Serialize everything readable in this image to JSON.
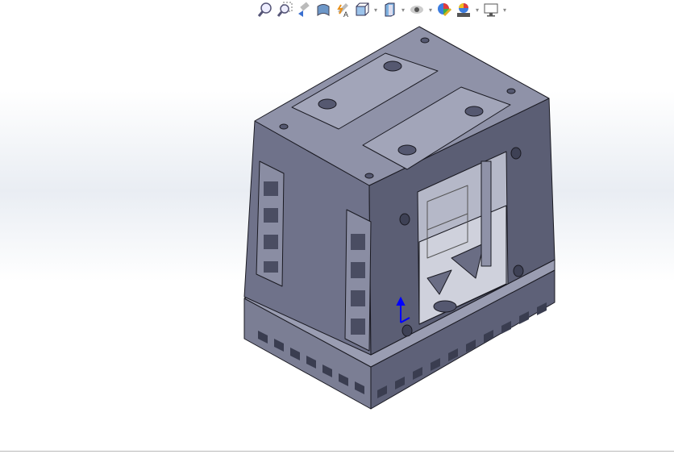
{
  "toolbar": {
    "items": [
      {
        "icon": "zoom-to-fit-icon"
      },
      {
        "icon": "zoom-to-area-icon"
      },
      {
        "icon": "previous-view-icon"
      },
      {
        "icon": "section-view-icon"
      },
      {
        "icon": "dynamic-annotation-views-icon"
      },
      {
        "icon": "view-orientation-icon",
        "dropdown": true
      },
      {
        "icon": "display-style-icon",
        "dropdown": true
      },
      {
        "icon": "hide-show-items-icon",
        "dropdown": true
      },
      {
        "icon": "edit-appearance-icon"
      },
      {
        "icon": "apply-scene-icon",
        "dropdown": true
      },
      {
        "icon": "view-settings-icon",
        "dropdown": true
      }
    ]
  },
  "colors": {
    "model_top": "#8f92a8",
    "model_left": "#6e7188",
    "model_right": "#5a5d73",
    "edge": "#1a1a22",
    "triad": "#0000ff"
  }
}
